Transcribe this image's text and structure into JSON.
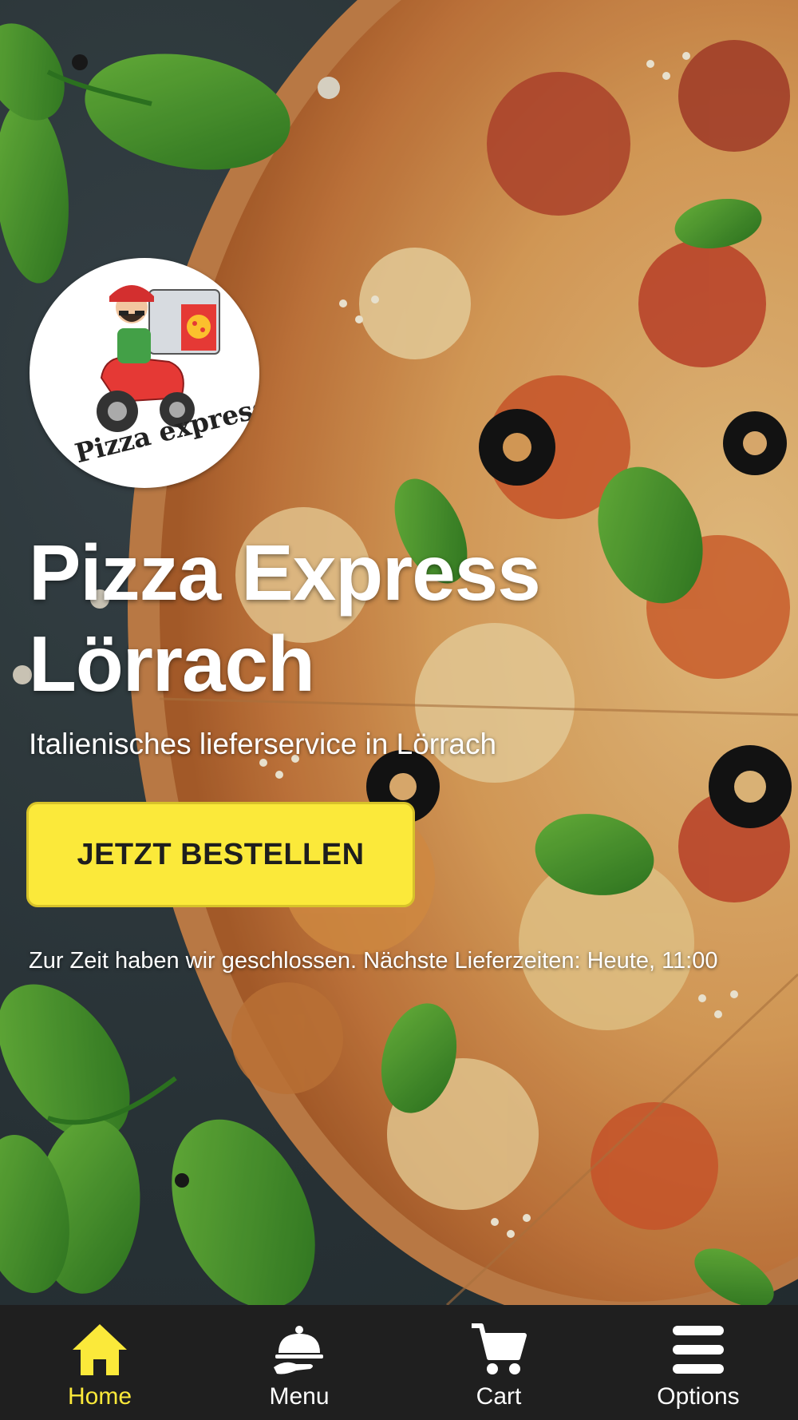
{
  "brand": {
    "logo_text": "Pizza express",
    "title": "Pizza Express Lörrach",
    "subtitle": "Italienisches lieferservice in Lörrach"
  },
  "cta": {
    "label": "JETZT BESTELLEN"
  },
  "status": {
    "text": "Zur Zeit haben wir geschlossen. Nächste Lieferzeiten: Heute, 11:00"
  },
  "nav": {
    "items": [
      {
        "label": "Home",
        "icon": "home-icon",
        "active": true
      },
      {
        "label": "Menu",
        "icon": "cloche-icon",
        "active": false
      },
      {
        "label": "Cart",
        "icon": "cart-icon",
        "active": false
      },
      {
        "label": "Options",
        "icon": "menu-bars-icon",
        "active": false
      }
    ]
  },
  "colors": {
    "accent": "#fbe93a",
    "nav_bg": "#1f1f1f",
    "text": "#ffffff"
  }
}
